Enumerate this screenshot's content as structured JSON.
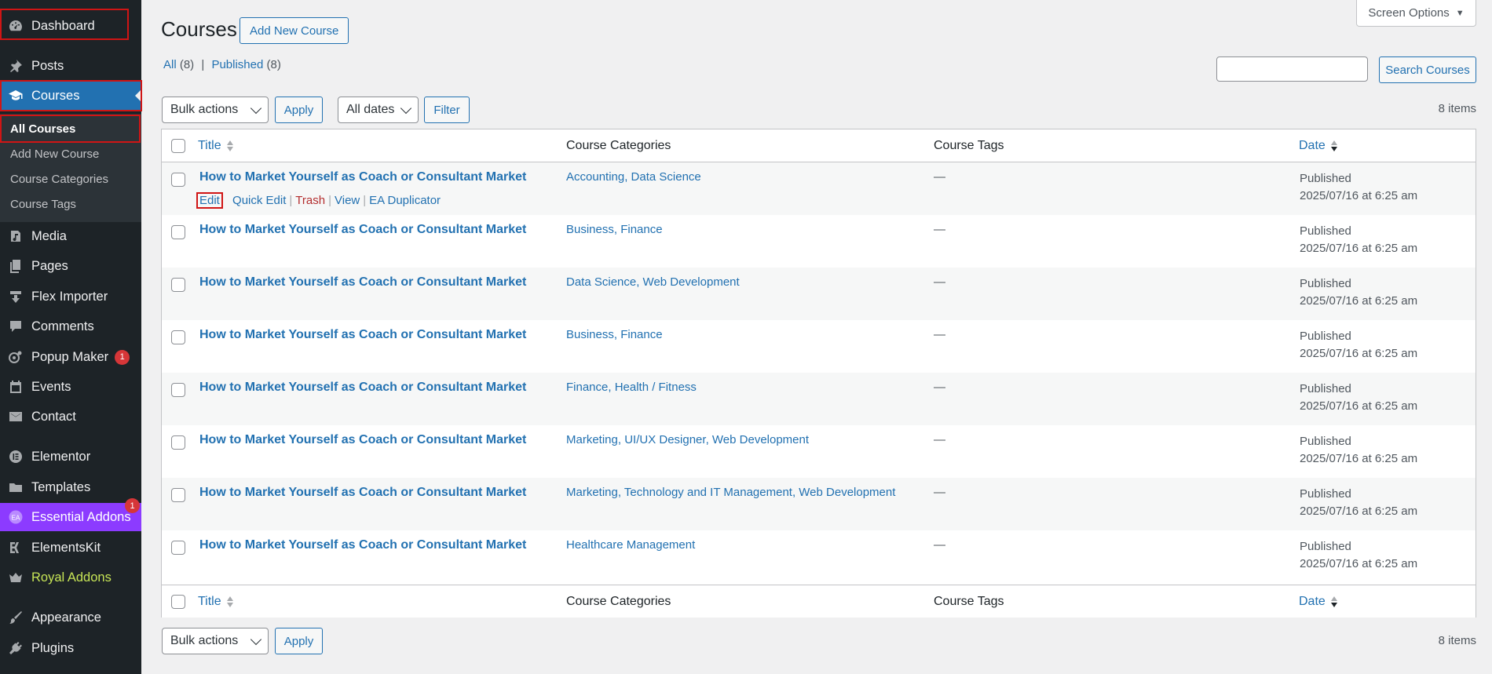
{
  "sidebar": {
    "items": [
      {
        "label": "Dashboard",
        "icon": "gauge-icon"
      },
      {
        "label": "Posts",
        "icon": "pin-icon"
      },
      {
        "label": "Courses",
        "icon": "graduation-cap-icon"
      },
      {
        "label": "Media",
        "icon": "media-icon"
      },
      {
        "label": "Pages",
        "icon": "pages-icon"
      },
      {
        "label": "Flex Importer",
        "icon": "download-icon"
      },
      {
        "label": "Comments",
        "icon": "comment-icon"
      },
      {
        "label": "Popup Maker",
        "icon": "popup-icon",
        "badge": "1"
      },
      {
        "label": "Events",
        "icon": "calendar-icon"
      },
      {
        "label": "Contact",
        "icon": "mail-icon"
      },
      {
        "label": "Elementor",
        "icon": "elementor-icon"
      },
      {
        "label": "Templates",
        "icon": "folder-icon"
      },
      {
        "label": "Essential Addons",
        "icon": "ea-icon",
        "badge": "1"
      },
      {
        "label": "ElementsKit",
        "icon": "ek-icon"
      },
      {
        "label": "Royal Addons",
        "icon": "crown-icon"
      },
      {
        "label": "Appearance",
        "icon": "brush-icon"
      },
      {
        "label": "Plugins",
        "icon": "plug-icon"
      }
    ],
    "submenu": [
      "All Courses",
      "Add New Course",
      "Course Categories",
      "Course Tags"
    ]
  },
  "header": {
    "title": "Courses",
    "add_new": "Add New Course",
    "screen_options": "Screen Options"
  },
  "filters": {
    "all_label": "All",
    "all_count": "(8)",
    "published_label": "Published",
    "published_count": "(8)",
    "separator": "|",
    "search_button": "Search Courses",
    "bulk_actions": "Bulk actions",
    "apply": "Apply",
    "dates": "All dates",
    "filter": "Filter",
    "items_count": "8 items"
  },
  "table": {
    "columns": {
      "title": "Title",
      "categories": "Course Categories",
      "tags": "Course Tags",
      "date": "Date"
    },
    "row_actions": {
      "edit": "Edit",
      "quick_edit": "Quick Edit",
      "trash": "Trash",
      "view": "View",
      "duplicator": "EA Duplicator"
    },
    "rows": [
      {
        "title": "How to Market Yourself as Coach or Consultant Market",
        "categories": "Accounting, Data Science",
        "tags": "—",
        "status": "Published",
        "date": "2025/07/16 at 6:25 am"
      },
      {
        "title": "How to Market Yourself as Coach or Consultant Market",
        "categories": "Business, Finance",
        "tags": "—",
        "status": "Published",
        "date": "2025/07/16 at 6:25 am"
      },
      {
        "title": "How to Market Yourself as Coach or Consultant Market",
        "categories": "Data Science, Web Development",
        "tags": "—",
        "status": "Published",
        "date": "2025/07/16 at 6:25 am"
      },
      {
        "title": "How to Market Yourself as Coach or Consultant Market",
        "categories": "Business, Finance",
        "tags": "—",
        "status": "Published",
        "date": "2025/07/16 at 6:25 am"
      },
      {
        "title": "How to Market Yourself as Coach or Consultant Market",
        "categories": "Finance, Health / Fitness",
        "tags": "—",
        "status": "Published",
        "date": "2025/07/16 at 6:25 am"
      },
      {
        "title": "How to Market Yourself as Coach or Consultant Market",
        "categories": "Marketing, UI/UX Designer, Web Development",
        "tags": "—",
        "status": "Published",
        "date": "2025/07/16 at 6:25 am"
      },
      {
        "title": "How to Market Yourself as Coach or Consultant Market",
        "categories": "Marketing, Technology and IT Management, Web Development",
        "tags": "—",
        "status": "Published",
        "date": "2025/07/16 at 6:25 am"
      },
      {
        "title": "How to Market Yourself as Coach or Consultant Market",
        "categories": "Healthcare Management",
        "tags": "—",
        "status": "Published",
        "date": "2025/07/16 at 6:25 am"
      }
    ]
  },
  "colors": {
    "sidebar_bg": "#1d2327",
    "accent": "#2271b1",
    "essential_addons": "#8c3bff",
    "royal_addons_text": "#c7e556",
    "highlight": "#d01515"
  }
}
